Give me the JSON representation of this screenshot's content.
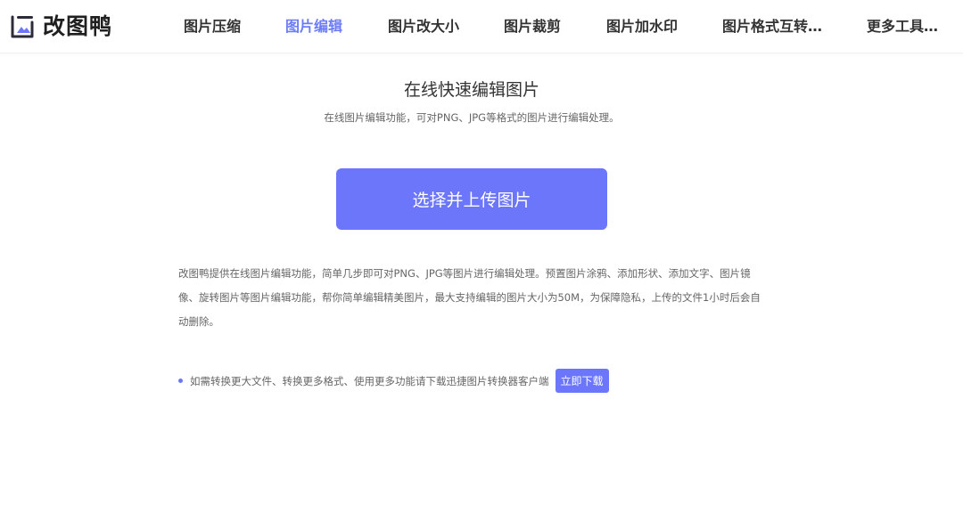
{
  "brand": {
    "name": "改图鸭",
    "icon": "picture-frame-icon",
    "color": "#6b76fa"
  },
  "nav": {
    "items": [
      {
        "label": "图片压缩",
        "active": false
      },
      {
        "label": "图片编辑",
        "active": true
      },
      {
        "label": "图片改大小",
        "active": false
      },
      {
        "label": "图片裁剪",
        "active": false
      },
      {
        "label": "图片加水印",
        "active": false
      },
      {
        "label": "图片格式互转…",
        "active": false
      },
      {
        "label": "更多工具…",
        "active": false
      }
    ]
  },
  "main": {
    "title": "在线快速编辑图片",
    "subtitle": "在线图片编辑功能，可对PNG、JPG等格式的图片进行编辑处理。",
    "upload_label": "选择并上传图片",
    "description": "改图鸭提供在线图片编辑功能，简单几步即可对PNG、JPG等图片进行编辑处理。预置图片涂鸦、添加形状、添加文字、图片镜像、旋转图片等图片编辑功能，帮你简单编辑精美图片，最大支持编辑的图片大小为50M，为保障隐私，上传的文件1小时后会自动删除。",
    "notice_text": "如需转换更大文件、转换更多格式、使用更多功能请下载迅捷图片转换器客户端",
    "download_label": "立即下载"
  },
  "colors": {
    "accent": "#6b76fa",
    "nav_active": "#6c7cf6",
    "text": "#333333",
    "muted": "#666666"
  }
}
